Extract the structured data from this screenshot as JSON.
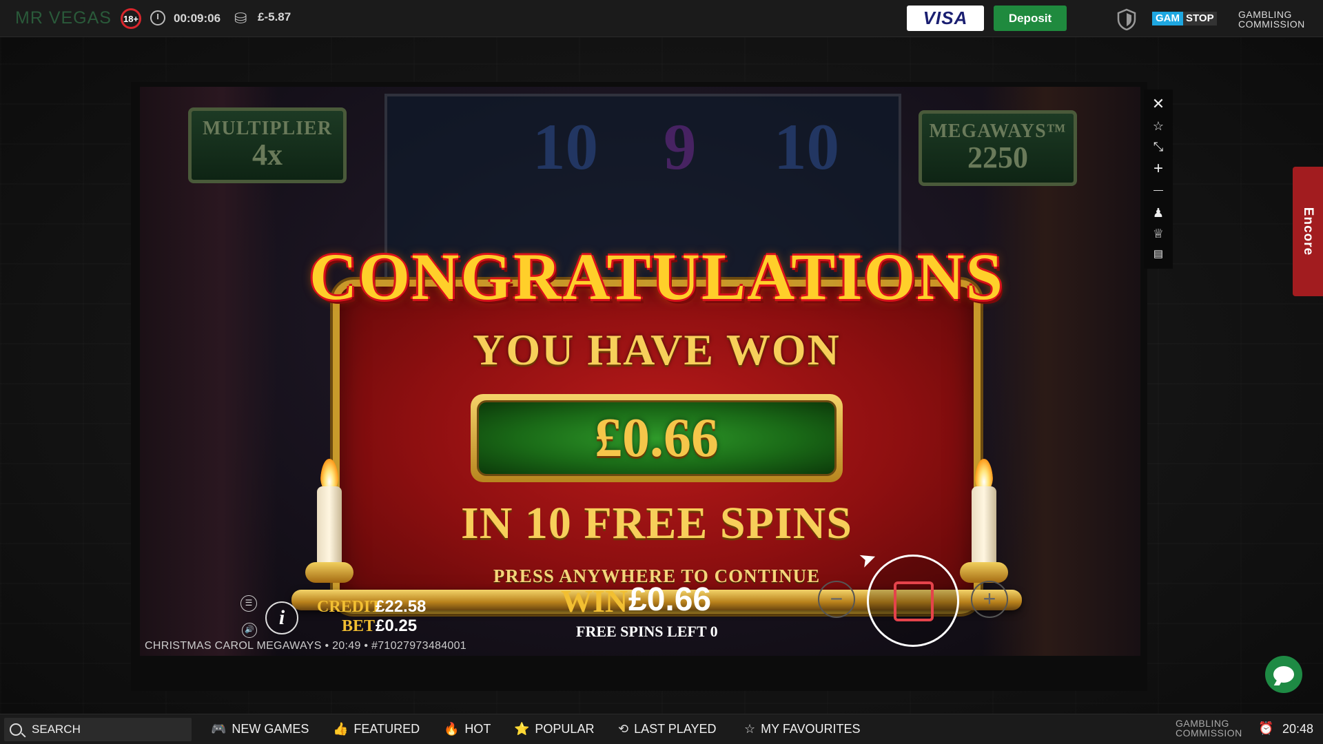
{
  "topbar": {
    "logo": "MR VEGAS",
    "age_badge": "18+",
    "session_time": "00:09:06",
    "balance_change": "£-5.87",
    "visa_label": "VISA",
    "deposit_label": "Deposit",
    "gamstop_a": "GAM",
    "gamstop_b": "STOP",
    "gambling_commission_line1": "GAMBLING",
    "gambling_commission_line2": "COMMISSION"
  },
  "game": {
    "multiplier_title": "MULTIPLIER",
    "multiplier_value": "4x",
    "megaways_title": "MEGAWAYS™",
    "megaways_value": "2250",
    "congrats_title": "CONGRATULATIONS",
    "you_have_won": "YOU HAVE WON",
    "win_amount": "£0.66",
    "in_free_spins": "IN 10 FREE SPINS",
    "press_continue": "PRESS ANYWHERE TO CONTINUE",
    "credit_label": "CREDIT",
    "credit_value": "£22.58",
    "bet_label": "BET",
    "bet_value": "£0.25",
    "game_info": "CHRISTMAS CAROL MEGAWAYS • 20:49 • #71027973484001",
    "win_label": "WIN",
    "win_value": "£0.66",
    "free_spins_left": "FREE SPINS LEFT 0",
    "bg_numbers": [
      "10",
      "9",
      "10"
    ]
  },
  "side_tools": {
    "close": "✕",
    "favourite": "☆",
    "shrink": "⤡",
    "zoom_in": "+",
    "zoom_out": "—",
    "user": "♟",
    "trophy": "♕",
    "chat": "▤"
  },
  "encore_label": "Encore",
  "bottombar": {
    "search_label": "SEARCH",
    "nav": [
      {
        "icon": "🎮",
        "label": "NEW GAMES"
      },
      {
        "icon": "👍",
        "label": "FEATURED"
      },
      {
        "icon": "🔥",
        "label": "HOT"
      },
      {
        "icon": "⭐",
        "label": "POPULAR"
      },
      {
        "icon": "⟲",
        "label": "LAST PLAYED"
      },
      {
        "icon": "☆",
        "label": "MY FAVOURITES"
      }
    ],
    "gambling_commission_line1": "GAMBLING",
    "gambling_commission_line2": "COMMISSION",
    "clock": "20:48"
  }
}
